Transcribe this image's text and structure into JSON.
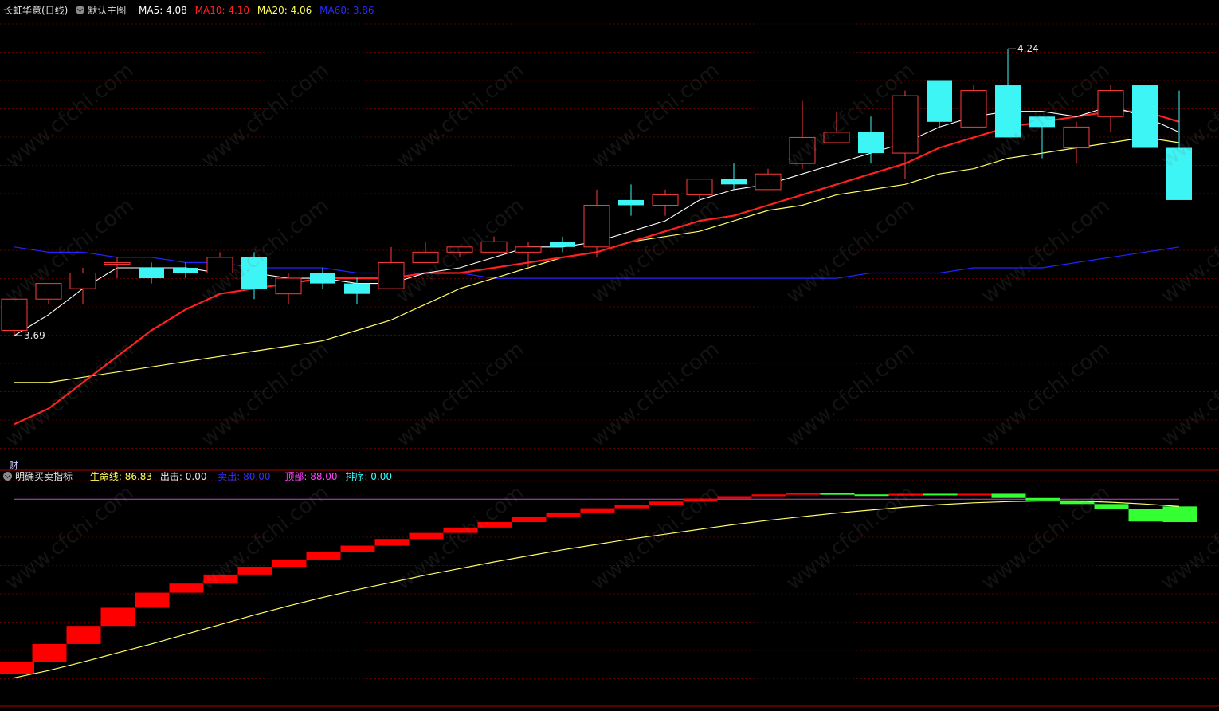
{
  "header": {
    "title": "长虹华意(日线)",
    "main_label": "默认主图",
    "ma5": "MA5: 4.08",
    "ma10": "MA10: 4.10",
    "ma20": "MA20: 4.06",
    "ma60": "MA60: 3.86"
  },
  "indicator_header": {
    "title": "明确买卖指标",
    "life_line": "生命线: 86.83",
    "exit": "出击: 0.00",
    "sell": "卖出: 80.00",
    "top": "顶部: 88.00",
    "rank": "排序: 0.00"
  },
  "side_label": "财",
  "watermark": "www.cfchi.com",
  "colors": {
    "up": "#ff3b3b",
    "down": "#3ef5f5",
    "ma5": "#ffffff",
    "ma10": "#ff2020",
    "ma20": "#ffff66",
    "ma60": "#2222ff",
    "life": "#ffff66",
    "indicator_up": "#ff0000",
    "indicator_down": "#33ff33",
    "top_line": "#cc44cc"
  },
  "chart_data": {
    "type": "candlestick",
    "price_range": [
      3.45,
      4.3
    ],
    "annotations": {
      "high_label": "4.24",
      "low_label": "3.69"
    },
    "candles": [
      {
        "o": 3.7,
        "h": 3.76,
        "l": 3.69,
        "c": 3.76
      },
      {
        "o": 3.76,
        "h": 3.79,
        "l": 3.75,
        "c": 3.79
      },
      {
        "o": 3.78,
        "h": 3.82,
        "l": 3.75,
        "c": 3.81
      },
      {
        "o": 3.83,
        "h": 3.84,
        "l": 3.8,
        "c": 3.83
      },
      {
        "o": 3.82,
        "h": 3.83,
        "l": 3.79,
        "c": 3.8
      },
      {
        "o": 3.82,
        "h": 3.83,
        "l": 3.8,
        "c": 3.81
      },
      {
        "o": 3.81,
        "h": 3.85,
        "l": 3.81,
        "c": 3.84
      },
      {
        "o": 3.84,
        "h": 3.85,
        "l": 3.76,
        "c": 3.78
      },
      {
        "o": 3.77,
        "h": 3.81,
        "l": 3.75,
        "c": 3.8
      },
      {
        "o": 3.81,
        "h": 3.82,
        "l": 3.78,
        "c": 3.79
      },
      {
        "o": 3.79,
        "h": 3.8,
        "l": 3.75,
        "c": 3.77
      },
      {
        "o": 3.78,
        "h": 3.86,
        "l": 3.78,
        "c": 3.83
      },
      {
        "o": 3.83,
        "h": 3.87,
        "l": 3.83,
        "c": 3.85
      },
      {
        "o": 3.85,
        "h": 3.86,
        "l": 3.84,
        "c": 3.86
      },
      {
        "o": 3.85,
        "h": 3.88,
        "l": 3.85,
        "c": 3.87
      },
      {
        "o": 3.85,
        "h": 3.87,
        "l": 3.82,
        "c": 3.86
      },
      {
        "o": 3.87,
        "h": 3.88,
        "l": 3.85,
        "c": 3.86
      },
      {
        "o": 3.86,
        "h": 3.97,
        "l": 3.84,
        "c": 3.94
      },
      {
        "o": 3.95,
        "h": 3.98,
        "l": 3.92,
        "c": 3.94
      },
      {
        "o": 3.94,
        "h": 3.97,
        "l": 3.92,
        "c": 3.96
      },
      {
        "o": 3.96,
        "h": 3.99,
        "l": 3.95,
        "c": 3.99
      },
      {
        "o": 3.99,
        "h": 4.02,
        "l": 3.97,
        "c": 3.98
      },
      {
        "o": 3.97,
        "h": 4.01,
        "l": 3.97,
        "c": 4.0
      },
      {
        "o": 4.02,
        "h": 4.14,
        "l": 4.01,
        "c": 4.07
      },
      {
        "o": 4.06,
        "h": 4.12,
        "l": 4.06,
        "c": 4.08
      },
      {
        "o": 4.08,
        "h": 4.11,
        "l": 4.02,
        "c": 4.04
      },
      {
        "o": 4.04,
        "h": 4.16,
        "l": 3.99,
        "c": 4.15
      },
      {
        "o": 4.18,
        "h": 4.18,
        "l": 4.09,
        "c": 4.1
      },
      {
        "o": 4.09,
        "h": 4.17,
        "l": 4.09,
        "c": 4.16
      },
      {
        "o": 4.17,
        "h": 4.24,
        "l": 4.07,
        "c": 4.07
      },
      {
        "o": 4.11,
        "h": 4.11,
        "l": 4.03,
        "c": 4.09
      },
      {
        "o": 4.05,
        "h": 4.1,
        "l": 4.02,
        "c": 4.09
      },
      {
        "o": 4.11,
        "h": 4.17,
        "l": 4.08,
        "c": 4.16
      },
      {
        "o": 4.17,
        "h": 4.17,
        "l": 4.05,
        "c": 4.05
      },
      {
        "o": 4.05,
        "h": 4.16,
        "l": 3.97,
        "c": 3.95
      }
    ],
    "ma5": [
      3.69,
      3.73,
      3.78,
      3.82,
      3.82,
      3.82,
      3.81,
      3.81,
      3.8,
      3.8,
      3.79,
      3.79,
      3.81,
      3.82,
      3.84,
      3.86,
      3.86,
      3.87,
      3.89,
      3.91,
      3.95,
      3.97,
      3.98,
      4.0,
      4.02,
      4.04,
      4.06,
      4.09,
      4.11,
      4.12,
      4.12,
      4.11,
      4.13,
      4.11,
      4.08
    ],
    "ma10": [
      3.52,
      3.55,
      3.6,
      3.65,
      3.7,
      3.74,
      3.77,
      3.78,
      3.79,
      3.8,
      3.8,
      3.8,
      3.81,
      3.81,
      3.82,
      3.83,
      3.84,
      3.85,
      3.87,
      3.89,
      3.91,
      3.92,
      3.94,
      3.96,
      3.98,
      4.0,
      4.02,
      4.05,
      4.07,
      4.09,
      4.1,
      4.11,
      4.12,
      4.12,
      4.1
    ],
    "ma20": [
      3.6,
      3.6,
      3.61,
      3.62,
      3.63,
      3.64,
      3.65,
      3.66,
      3.67,
      3.68,
      3.7,
      3.72,
      3.75,
      3.78,
      3.8,
      3.82,
      3.84,
      3.85,
      3.87,
      3.88,
      3.89,
      3.91,
      3.93,
      3.94,
      3.96,
      3.97,
      3.98,
      4.0,
      4.01,
      4.03,
      4.04,
      4.05,
      4.06,
      4.07,
      4.06
    ],
    "ma60": [
      3.86,
      3.85,
      3.85,
      3.84,
      3.84,
      3.83,
      3.83,
      3.82,
      3.82,
      3.82,
      3.81,
      3.81,
      3.81,
      3.81,
      3.8,
      3.8,
      3.8,
      3.8,
      3.8,
      3.8,
      3.8,
      3.8,
      3.8,
      3.8,
      3.8,
      3.81,
      3.81,
      3.81,
      3.82,
      3.82,
      3.82,
      3.83,
      3.84,
      3.85,
      3.86
    ],
    "indicator": {
      "range": [
        55,
        92
      ],
      "top_value": 88.0,
      "bars": [
        {
          "from": 59,
          "to": 61,
          "dir": "up"
        },
        {
          "from": 61,
          "to": 64,
          "dir": "up"
        },
        {
          "from": 64,
          "to": 67,
          "dir": "up"
        },
        {
          "from": 67,
          "to": 70,
          "dir": "up"
        },
        {
          "from": 70,
          "to": 72.5,
          "dir": "up"
        },
        {
          "from": 72.5,
          "to": 74,
          "dir": "up"
        },
        {
          "from": 74,
          "to": 75.5,
          "dir": "up"
        },
        {
          "from": 75.5,
          "to": 76.8,
          "dir": "up"
        },
        {
          "from": 76.8,
          "to": 78,
          "dir": "up"
        },
        {
          "from": 78,
          "to": 79.2,
          "dir": "up"
        },
        {
          "from": 79.2,
          "to": 80.3,
          "dir": "up"
        },
        {
          "from": 80.3,
          "to": 81.4,
          "dir": "up"
        },
        {
          "from": 81.4,
          "to": 82.4,
          "dir": "up"
        },
        {
          "from": 82.4,
          "to": 83.3,
          "dir": "up"
        },
        {
          "from": 83.3,
          "to": 84.2,
          "dir": "up"
        },
        {
          "from": 84.2,
          "to": 85,
          "dir": "up"
        },
        {
          "from": 85,
          "to": 85.8,
          "dir": "up"
        },
        {
          "from": 85.8,
          "to": 86.5,
          "dir": "up"
        },
        {
          "from": 86.5,
          "to": 87.1,
          "dir": "up"
        },
        {
          "from": 87.1,
          "to": 87.6,
          "dir": "up"
        },
        {
          "from": 87.6,
          "to": 88.1,
          "dir": "up"
        },
        {
          "from": 88.1,
          "to": 88.5,
          "dir": "up"
        },
        {
          "from": 88.5,
          "to": 88.8,
          "dir": "up"
        },
        {
          "from": 88.8,
          "to": 89.0,
          "dir": "up"
        },
        {
          "from": 89.0,
          "to": 88.8,
          "dir": "down"
        },
        {
          "from": 88.8,
          "to": 88.6,
          "dir": "down"
        },
        {
          "from": 88.6,
          "to": 88.9,
          "dir": "up"
        },
        {
          "from": 88.9,
          "to": 88.7,
          "dir": "down"
        },
        {
          "from": 88.7,
          "to": 88.9,
          "dir": "up"
        },
        {
          "from": 88.9,
          "to": 88.2,
          "dir": "down"
        },
        {
          "from": 88.2,
          "to": 87.8,
          "dir": "down"
        },
        {
          "from": 87.8,
          "to": 87.2,
          "dir": "down"
        },
        {
          "from": 87.2,
          "to": 86.4,
          "dir": "down"
        },
        {
          "from": 86.4,
          "to": 84.3,
          "dir": "down"
        },
        {
          "from": 86.8,
          "to": 84.2,
          "dir": "down"
        }
      ],
      "life_line": [
        58.4,
        59.6,
        61.0,
        62.5,
        64.0,
        65.6,
        67.2,
        68.8,
        70.3,
        71.7,
        73.0,
        74.2,
        75.4,
        76.5,
        77.6,
        78.6,
        79.6,
        80.5,
        81.4,
        82.2,
        83.0,
        83.8,
        84.5,
        85.1,
        85.7,
        86.2,
        86.7,
        87.1,
        87.4,
        87.6,
        87.7,
        87.7,
        87.5,
        87.2,
        86.8
      ]
    }
  }
}
